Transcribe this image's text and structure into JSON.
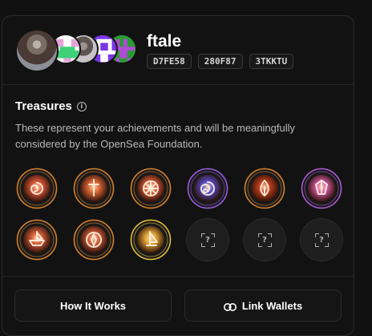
{
  "profile": {
    "username": "ftale",
    "addresses": [
      "D7FE58",
      "280F87",
      "3TKKTU"
    ],
    "avatars": [
      "profile-photo-avatar",
      "pixel-avatar-green-pink",
      "photo-avatar-gray",
      "pixel-avatar-purple",
      "pixel-avatar-green"
    ]
  },
  "treasures": {
    "title": "Treasures",
    "info_icon": "info-icon",
    "description": "These represent your achievements and will be meaningfully considered by the OpenSea Foundation.",
    "badges": [
      {
        "state": "earned",
        "ring": "#d9822b",
        "glow": "#e05a3a",
        "glyph": "swirl"
      },
      {
        "state": "earned",
        "ring": "#d9822b",
        "glow": "#e06a3a",
        "glyph": "cross"
      },
      {
        "state": "earned",
        "ring": "#d9822b",
        "glow": "#e0603a",
        "glyph": "wheel"
      },
      {
        "state": "earned",
        "ring": "#9b5de5",
        "glow": "#5b4fd0",
        "glyph": "spiral"
      },
      {
        "state": "earned",
        "ring": "#d9822b",
        "glow": "#c2401f",
        "glyph": "flame"
      },
      {
        "state": "earned",
        "ring": "#b05ad8",
        "glow": "#d85aa8",
        "glyph": "shards"
      },
      {
        "state": "earned",
        "ring": "#d9822b",
        "glow": "#d8603a",
        "glyph": "ship"
      },
      {
        "state": "earned",
        "ring": "#d9822b",
        "glow": "#d8603a",
        "glyph": "compass"
      },
      {
        "state": "earned",
        "ring": "#e4c23a",
        "glow": "#e5a83a",
        "glyph": "sail"
      },
      {
        "state": "locked",
        "label": "?"
      },
      {
        "state": "locked",
        "label": "?"
      },
      {
        "state": "locked",
        "label": "?"
      }
    ]
  },
  "footer": {
    "how_it_works": "How It Works",
    "link_wallets": "Link Wallets",
    "link_icon": "link-icon"
  }
}
